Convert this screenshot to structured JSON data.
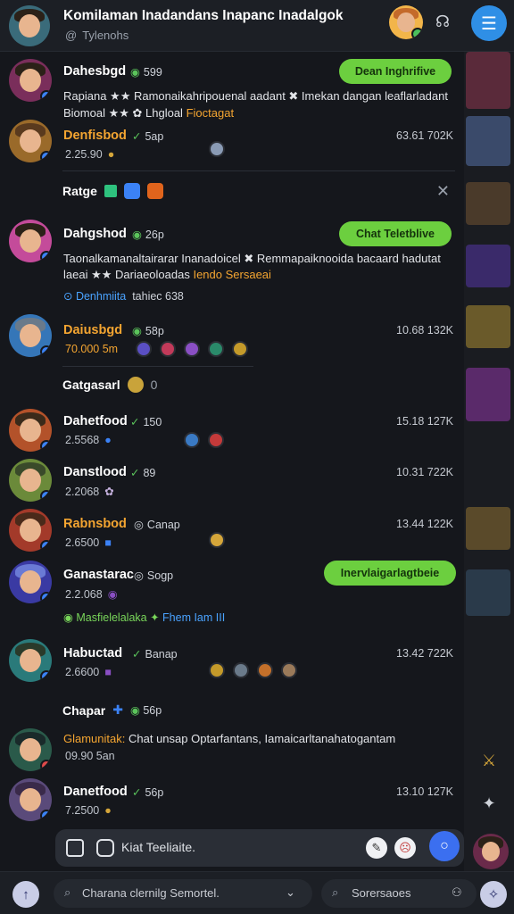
{
  "header": {
    "title": "Komilaman Inadandans Inapanc Inadalgok",
    "subtitle": "Tylenohs",
    "accent": "#2f8fe6"
  },
  "feed": [
    {
      "name": "Dahesbgd",
      "tag": "599",
      "pill": "Dean Inghrifive",
      "msg": "Rapiana ★★ Ramonaikahripouenal aadant ✖ Imekan dangan leaflarladant",
      "msg2_a": "Biomoal",
      "msg2_b": "★★ ✿ Lhgloal",
      "msg2_hl": "Fioctagat"
    },
    {
      "name": "Denfisbod",
      "tag": "5ap",
      "meta": "2.25.90",
      "time": "63.61 702K"
    },
    {
      "name": "Dahgshod",
      "tag": "26p",
      "pill": "Chat Teletblive",
      "msg": "Taonalkamanaltairarar Inanadoicel ✖ Remmapaiknooida bacaard hadutat",
      "msg2_a": "laeai ★★ Dariaeoloadas",
      "msg2_hl": "Iendo Sersaeai",
      "link_blue": "Denhmiita",
      "link_rest": "tahiec 638"
    },
    {
      "name": "Daiusbgd",
      "tag": "58p",
      "meta_hl": "70.000 5m",
      "time": "10.68 132K"
    },
    {
      "name": "Dahetfood",
      "tag": "150",
      "meta": "2.5568",
      "time": "15.18 127K"
    },
    {
      "name": "Danstlood",
      "tag": "89",
      "meta": "2.2068",
      "time": "10.31 722K"
    },
    {
      "name": "Rabnsbod",
      "tag": "Canap",
      "meta": "2.6500",
      "time": "13.44 122K"
    },
    {
      "name": "Ganastarac",
      "tag": "Sogp",
      "meta": "2.2.068",
      "pill": "Inervlaigarlagtbeie",
      "link_green": "Masfielelalaka ✦",
      "link_blue": "Fhem Iam",
      "link_rest": "III"
    },
    {
      "name": "Habuctad",
      "tag": "Banap",
      "meta": "2.6600",
      "time": "13.42 722K"
    },
    {
      "name": "Glamunitak:",
      "msg": "Chat unsap Optarfantans, Iamaicarltanahatogantam",
      "meta": "09.90 5an"
    },
    {
      "name": "Danetfood",
      "tag": "56p",
      "meta": "7.2500",
      "time": "13.10 127K"
    }
  ],
  "sections": {
    "ratge": "Ratge",
    "getgasari": "Gatgasarl",
    "getgasari_suffix": "0",
    "chapar": "Chapar",
    "chapar_tag": "56p"
  },
  "composer": {
    "placeholder": "Kiat Teeliaite."
  },
  "bottombar": {
    "search_left": "Charana clernilg Semortel.",
    "search_right": "Sorersaoes"
  }
}
